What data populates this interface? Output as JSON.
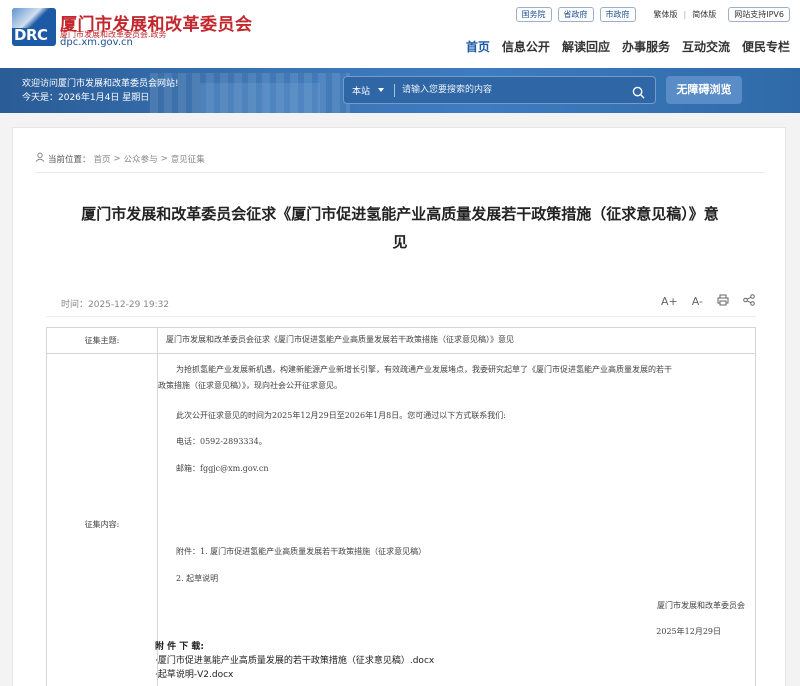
{
  "header": {
    "logo_text": "DRC",
    "site_title": "厦门市发展和改革委员会",
    "site_subtitle": "厦门市发展和改革委员会.政务",
    "domain": "dpc.xm.gov.cn",
    "top_links": [
      "国务院",
      "省政府",
      "市政府"
    ],
    "lang_traditional": "繁体版",
    "lang_simplified": "简体版",
    "ipv6": "网站支持IPV6",
    "nav": [
      "首页",
      "信息公开",
      "解读回应",
      "办事服务",
      "互动交流",
      "便民专栏"
    ]
  },
  "banner": {
    "welcome": "欢迎访问厦门市发展和改革委员会网站!",
    "today": "今天是：2026年1月4日 星期日",
    "search_scope": "本站",
    "search_placeholder": "请输入您要搜索的内容",
    "accessibility_button": "无障碍浏览"
  },
  "breadcrumb": {
    "label": "当前位置：",
    "items": [
      "首页",
      "公众参与",
      "意见征集"
    ],
    "separator": ">"
  },
  "article": {
    "title_line1": "厦门市发展和改革委员会征求《厦门市促进氢能产业高质量发展若干政策措施（征求意见稿）》意",
    "title_line2": "见",
    "time": "时间：2025-12-29 19:32",
    "tools": {
      "font_larger": "A+",
      "font_smaller": "A-"
    }
  },
  "table": {
    "subject_label": "征集主题:",
    "subject_value": "厦门市发展和改革委员会征求《厦门市促进氢能产业高质量发展若干政策措施（征求意见稿）》意见",
    "content_label": "征集内容:",
    "para1_line1": "为抢抓氢能产业发展新机遇，构建新能源产业新增长引擎，有效疏通产业发展堵点，我委研究起草了《厦门市促进氢能产业高质量发展的若干",
    "para1_line2": "政策措施（征求意见稿）》，现向社会公开征求意见。",
    "para2": "此次公开征求意见的时间为2025年12月29日至2026年1月8日。您可通过以下方式联系我们:",
    "phone": "电话：0592-2893334。",
    "email": "邮箱：fggjc@xm.gov.cn",
    "attachment_1": "附件：1. 厦门市促进氢能产业高质量发展若干政策措施（征求意见稿）",
    "attachment_2": "2. 起草说明",
    "signature_org": "厦门市发展和改革委员会",
    "signature_date": "2025年12月29日"
  },
  "downloads": {
    "header": "附 件 下 载:",
    "files": [
      "·厦门市促进氢能产业高质量发展的若干政策措施（征求意见稿）.docx",
      "·起草说明-V2.docx"
    ]
  }
}
